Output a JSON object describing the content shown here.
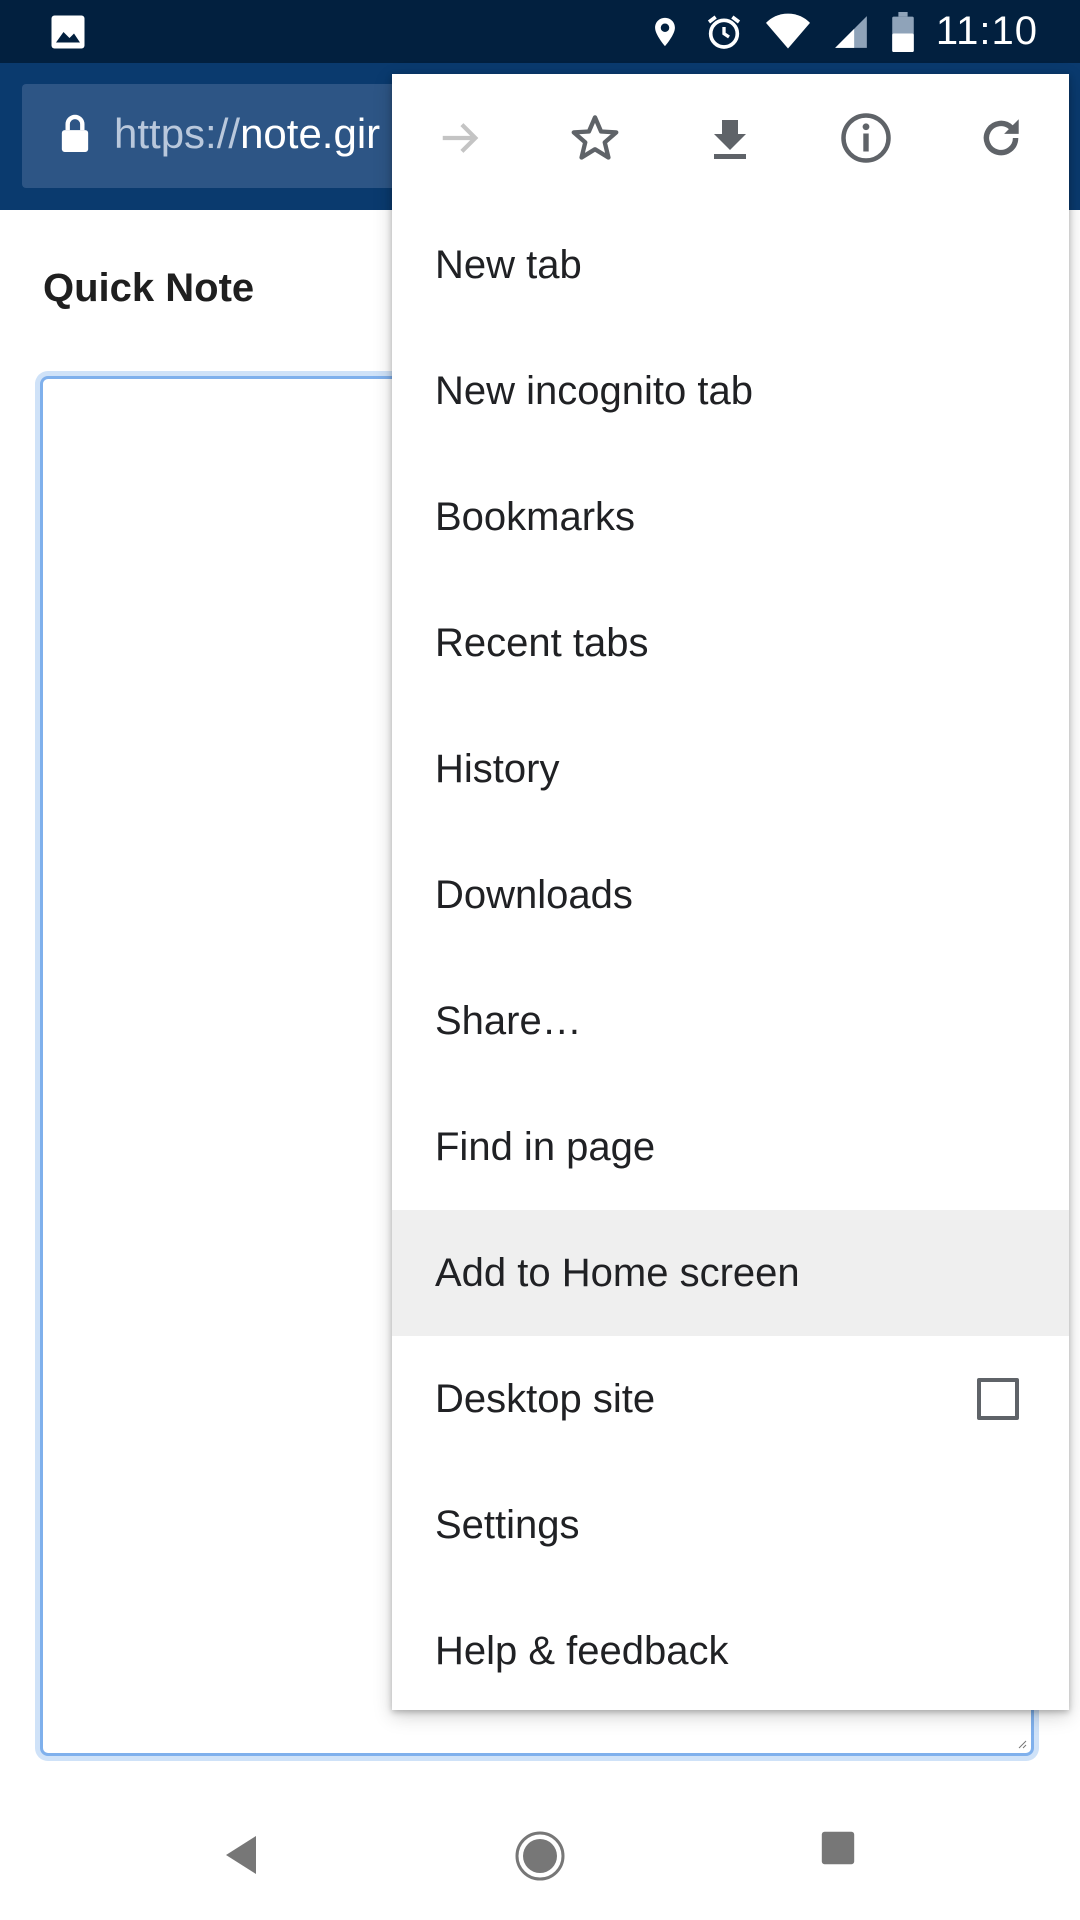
{
  "status_bar": {
    "time": "11:10",
    "icons": [
      "photo-icon",
      "location-icon",
      "alarm-icon",
      "wifi-icon",
      "signal-icon",
      "battery-icon"
    ]
  },
  "toolbar": {
    "url_scheme": "https://",
    "url_host": "note.gir"
  },
  "page": {
    "title": "Quick Note"
  },
  "menu": {
    "icon_row": [
      "forward-icon",
      "star-icon",
      "download-icon",
      "info-icon",
      "refresh-icon"
    ],
    "items": [
      {
        "label": "New tab"
      },
      {
        "label": "New incognito tab"
      },
      {
        "label": "Bookmarks"
      },
      {
        "label": "Recent tabs"
      },
      {
        "label": "History"
      },
      {
        "label": "Downloads"
      },
      {
        "label": "Share…"
      },
      {
        "label": "Find in page"
      },
      {
        "label": "Add to Home screen",
        "highlighted": true
      },
      {
        "label": "Desktop site",
        "checkbox": true,
        "checked": false
      },
      {
        "label": "Settings"
      },
      {
        "label": "Help & feedback"
      }
    ]
  },
  "nav_bar": {
    "buttons": [
      "back-icon",
      "home-icon",
      "recents-icon"
    ]
  },
  "colors": {
    "status_bar": "#02203f",
    "toolbar": "#0a3a6e",
    "url_box": "#2d5585",
    "highlight": "#efefef",
    "focus_border": "#7fb0ec"
  }
}
